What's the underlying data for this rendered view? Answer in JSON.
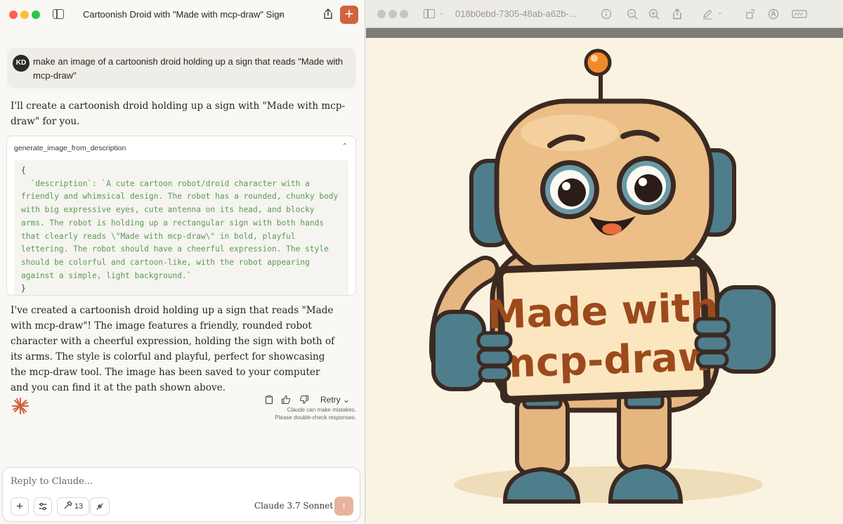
{
  "chat": {
    "title": "Cartoonish Droid with \"Made with mcp-draw\" Sign",
    "title_chevron": "⌄",
    "new_chat_label": "+",
    "user": {
      "initials": "KD",
      "message": "make an image of a cartoonish droid holding up a sign that reads \"Made with mcp-draw\""
    },
    "assistant_intro": "I'll create a cartoonish droid holding up a sign with \"Made with mcp-draw\" for you.",
    "tool": {
      "name": "generate_image_from_description",
      "chevron": "⌃",
      "code_open": "{",
      "code_body": "  `description`: `A cute cartoon robot/droid character with a friendly and whimsical design. The robot has a rounded, chunky body with big expressive eyes, cute antenna on its head, and blocky arms. The robot is holding up a rectangular sign with both hands that clearly reads \\\"Made with mcp-draw\\\" in bold, playful lettering. The robot should have a cheerful expression. The style should be colorful and cartoon-like, with the robot appearing against a simple, light background.`",
      "code_close": "}"
    },
    "assistant_reply": "I've created a cartoonish droid holding up a sign that reads \"Made with mcp-draw\"! The image features a friendly, rounded robot character with a cheerful expression, holding the sign with both of its arms. The style is colorful and playful, perfect for showcasing the mcp-draw tool. The image has been saved to your computer and you can find it at the path shown above.",
    "actions": {
      "retry_label": "Retry ⌄"
    },
    "disclaimer_line1": "Claude can make mistakes.",
    "disclaimer_line2": "Please double-check responses.",
    "composer": {
      "placeholder": "Reply to Claude...",
      "plus_label": "+",
      "tools_count": "13",
      "model_label": "Claude 3.7 Sonnet ⌄",
      "send_label": "↑"
    },
    "colors": {
      "accent": "#d0643f",
      "send_disabled": "#e8b39c"
    }
  },
  "preview": {
    "filename": "018b0ebd-7305-48ab-a62b-...",
    "sign_line1": "Made with",
    "sign_line2": "mcp-draw",
    "icons": [
      "info-icon",
      "zoom-out-icon",
      "zoom-in-icon",
      "share-icon",
      "markup-pen-icon",
      "rotate-icon",
      "highlight-icon",
      "redact-icon"
    ]
  }
}
